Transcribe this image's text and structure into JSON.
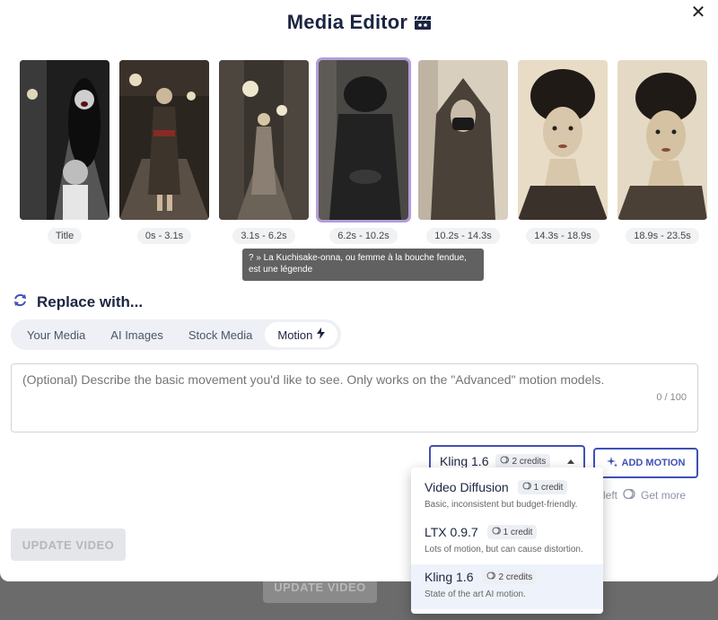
{
  "header": {
    "title": "Media Editor",
    "close_icon": "close-icon",
    "title_icon": "clapperboard-icon"
  },
  "thumbnails": [
    {
      "label": "Title"
    },
    {
      "label": "0s - 3.1s"
    },
    {
      "label": "3.1s - 6.2s"
    },
    {
      "label": "6.2s - 10.2s",
      "selected": true
    },
    {
      "label": "10.2s - 14.3s"
    },
    {
      "label": "14.3s - 18.9s"
    },
    {
      "label": "18.9s - 23.5s"
    }
  ],
  "tooltip": {
    "text": "? » La Kuchisake-onna, ou femme à la bouche fendue, est une légende"
  },
  "replace": {
    "label": "Replace with...",
    "icon": "refresh-icon"
  },
  "tabs": [
    {
      "label": "Your Media"
    },
    {
      "label": "AI Images"
    },
    {
      "label": "Stock Media"
    },
    {
      "label": "Motion",
      "active": true,
      "icon": "lightning-icon"
    }
  ],
  "motion_prompt": {
    "placeholder": "(Optional) Describe the basic movement you'd like to see. Only works on the \"Advanced\" motion models.",
    "counter": "0 / 100"
  },
  "model_select": {
    "selected": "Kling 1.6",
    "credits": "2 credits"
  },
  "add_motion": {
    "label": "ADD MOTION",
    "icon": "sparkle-icon"
  },
  "credits_info": {
    "left_text": "left",
    "get_more": "Get more"
  },
  "update_button": {
    "label": "UPDATE VIDEO"
  },
  "backdrop_button": {
    "label": "UPDATE VIDEO"
  },
  "dropdown": {
    "options": [
      {
        "name": "Video Diffusion",
        "credits": "1 credit",
        "desc": "Basic, inconsistent but budget-friendly."
      },
      {
        "name": "LTX 0.9.7",
        "credits": "1 credit",
        "desc": "Lots of motion, but can cause distortion."
      },
      {
        "name": "Kling 1.6",
        "credits": "2 credits",
        "desc": "State of the art AI motion.",
        "selected": true
      }
    ]
  },
  "colors": {
    "accent": "#3f51b5",
    "selected_outline": "#b39ddb",
    "title": "#1c2541"
  }
}
